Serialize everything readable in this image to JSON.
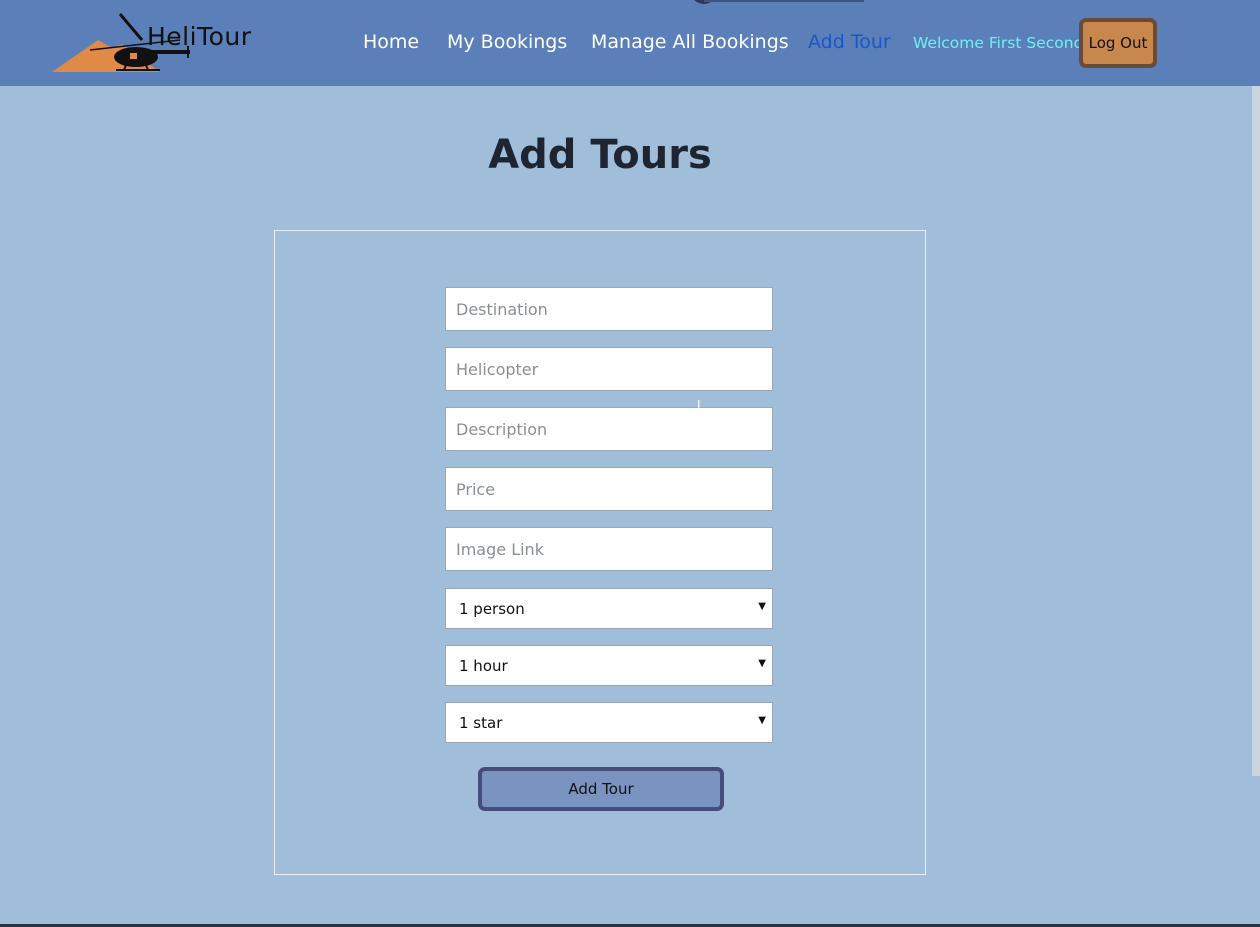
{
  "brand": {
    "name": "HeliTour"
  },
  "nav": {
    "items": [
      {
        "label": "Home"
      },
      {
        "label": "My Bookings"
      },
      {
        "label": "Manage All Bookings"
      },
      {
        "label": "Add Tour"
      }
    ],
    "active": "Add Tour",
    "welcome": "Welcome First Second",
    "logout_label": "Log Out"
  },
  "page": {
    "title": "Add Tours"
  },
  "form": {
    "destination": {
      "value": "",
      "placeholder": "Destination"
    },
    "helicopter": {
      "value": "",
      "placeholder": "Helicopter"
    },
    "description": {
      "value": "",
      "placeholder": "Description"
    },
    "price": {
      "value": "",
      "placeholder": "Price"
    },
    "image_link": {
      "value": "",
      "placeholder": "Image Link"
    },
    "capacity": {
      "selected": "1 person"
    },
    "duration": {
      "selected": "1 hour"
    },
    "rating": {
      "selected": "1 star"
    },
    "submit_label": "Add Tour"
  },
  "colors": {
    "navbar": "#5b7fb8",
    "page_bg": "#a0bdda",
    "active_link": "#1a56c9",
    "welcome": "#6ef0f0",
    "logout_bg": "#c7874d",
    "submit_bg": "#7b93c0"
  }
}
